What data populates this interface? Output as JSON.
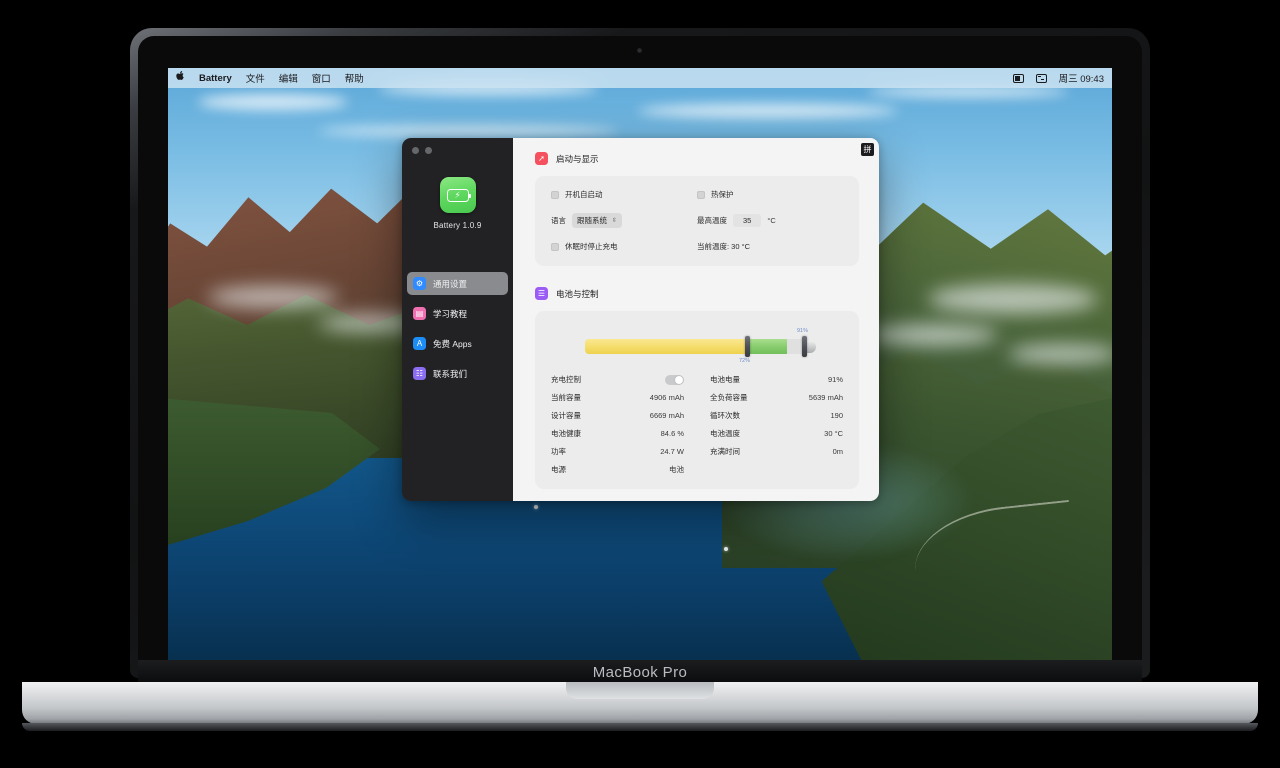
{
  "device": {
    "model_label": "MacBook Pro"
  },
  "menubar": {
    "apple_glyph": "A",
    "app_name": "Battery",
    "items": [
      "文件",
      "编辑",
      "窗口",
      "帮助"
    ],
    "status_icons": [
      "battery-icon",
      "control-center-icon"
    ],
    "clock": "周三 09:43"
  },
  "app_window": {
    "ime_badge": "拼",
    "sidebar": {
      "app_icon_name": "battery-charging-icon",
      "app_version_label": "Battery 1.0.9",
      "items": [
        {
          "label": "通用设置",
          "icon": "gear-icon",
          "glyph": "⚙",
          "color": "#2f8bff",
          "active": true
        },
        {
          "label": "学习教程",
          "icon": "book-icon",
          "glyph": "▤",
          "color": "#f06fb0",
          "active": false
        },
        {
          "label": "免费 Apps",
          "icon": "app-store-icon",
          "glyph": "A",
          "color": "#1c8cf7",
          "active": false
        },
        {
          "label": "联系我们",
          "icon": "contact-icon",
          "glyph": "☷",
          "color": "#8a6df0",
          "active": false
        }
      ]
    },
    "sections": [
      {
        "title": "启动与显示",
        "icon": "rocket-icon",
        "icon_glyph": "➚",
        "icon_color": "#f4505e",
        "checkboxes": [
          {
            "label": "开机自启动",
            "checked": false
          },
          {
            "label": "热保护",
            "checked": false
          },
          {
            "label": "休眠时停止充电",
            "checked": false
          }
        ],
        "language_label": "语言",
        "language_value": "跟随系统",
        "max_temp_label": "最高温度",
        "max_temp_value": "35",
        "max_temp_unit": "°C",
        "current_temp_text": "当前温度: 30 °C"
      },
      {
        "title": "电池与控制",
        "icon": "battery-control-icon",
        "icon_glyph": "☰",
        "icon_color": "#9a5cf5",
        "slider": {
          "lower_label": "72%",
          "upper_label": "91%",
          "lower_value": 72,
          "upper_value": 91,
          "yellow_color": "#f4dc6a",
          "green_color": "#86cb6c"
        },
        "charge_control_label": "充电控制",
        "charge_control_on": true,
        "stats_left": [
          {
            "key": "当前容量",
            "value": "4906 mAh"
          },
          {
            "key": "设计容量",
            "value": "6669 mAh"
          },
          {
            "key": "电池健康",
            "value": "84.6 %"
          },
          {
            "key": "功率",
            "value": "24.7 W"
          },
          {
            "key": "电源",
            "value": "电池"
          }
        ],
        "stats_right": [
          {
            "key": "电池电量",
            "value": "91%"
          },
          {
            "key": "全负荷容量",
            "value": "5639 mAh"
          },
          {
            "key": "循环次数",
            "value": "190"
          },
          {
            "key": "电池温度",
            "value": "30 °C"
          },
          {
            "key": "充满时间",
            "value": "0m"
          }
        ]
      }
    ]
  },
  "colors": {
    "sidebar_bg": "#222224",
    "content_bg": "#f4f4f4",
    "card_bg": "#ececec",
    "accent_green": "#5fd85f",
    "accent_purple": "#9a5cf5",
    "accent_red": "#f4505e"
  }
}
